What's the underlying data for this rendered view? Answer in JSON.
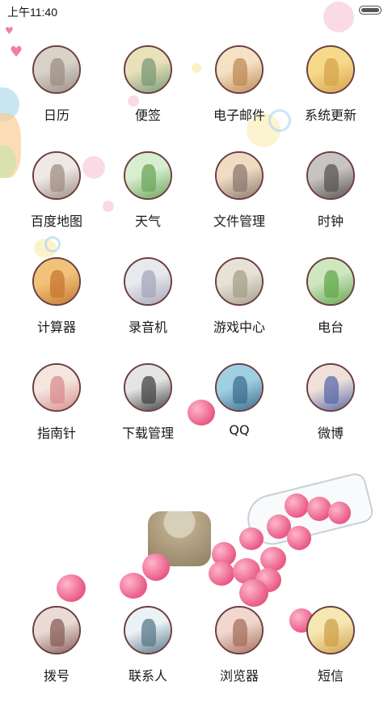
{
  "status_bar": {
    "time": "上午11:40"
  },
  "apps": [
    {
      "label": "日历",
      "icon": "photo-girl-icon",
      "palette": [
        "#d8d2c8",
        "#9c8f86"
      ]
    },
    {
      "label": "便签",
      "icon": "photo-swing-icon",
      "palette": [
        "#e9e1b9",
        "#7b9a78"
      ]
    },
    {
      "label": "电子邮件",
      "icon": "photo-couple-icon",
      "palette": [
        "#f5e2c4",
        "#c08a57"
      ]
    },
    {
      "label": "系统更新",
      "icon": "photo-sunset-icon",
      "palette": [
        "#f7d98a",
        "#d6a44c"
      ]
    },
    {
      "label": "百度地图",
      "icon": "photo-friends-icon",
      "palette": [
        "#efe9e6",
        "#a08f86"
      ]
    },
    {
      "label": "天气",
      "icon": "photo-meadow-icon",
      "palette": [
        "#d8eed0",
        "#6ea55c"
      ]
    },
    {
      "label": "文件管理",
      "icon": "photo-pier-icon",
      "palette": [
        "#f0dcc3",
        "#8b7a6f"
      ]
    },
    {
      "label": "时钟",
      "icon": "photo-couple-dark-icon",
      "palette": [
        "#c7c4c3",
        "#5a5553"
      ]
    },
    {
      "label": "计算器",
      "icon": "photo-hair-icon",
      "palette": [
        "#f2c27a",
        "#c5772f"
      ]
    },
    {
      "label": "录音机",
      "icon": "photo-seaside-icon",
      "palette": [
        "#e8e8ef",
        "#a7a7bb"
      ]
    },
    {
      "label": "游戏中心",
      "icon": "photo-lake-icon",
      "palette": [
        "#e6e3d6",
        "#a5a08a"
      ]
    },
    {
      "label": "电台",
      "icon": "photo-field-icon",
      "palette": [
        "#cfe6c1",
        "#64a84e"
      ]
    },
    {
      "label": "指南针",
      "icon": "photo-flower-icon",
      "palette": [
        "#f4e6df",
        "#d98e8e"
      ]
    },
    {
      "label": "下载管理",
      "icon": "photo-bw-girl-icon",
      "palette": [
        "#e5e5e5",
        "#444444"
      ]
    },
    {
      "label": "QQ",
      "icon": "photo-sky-icon",
      "palette": [
        "#9fd0e2",
        "#3d6f8f"
      ]
    },
    {
      "label": "微博",
      "icon": "photo-tattoo-icon",
      "palette": [
        "#efe1da",
        "#5b6aa8"
      ]
    }
  ],
  "dock": [
    {
      "label": "拨号",
      "icon": "photo-text-girl-icon",
      "palette": [
        "#eadbd7",
        "#8a5e5a"
      ]
    },
    {
      "label": "联系人",
      "icon": "photo-boy-text-icon",
      "palette": [
        "#eaf2f6",
        "#5c7889"
      ]
    },
    {
      "label": "浏览器",
      "icon": "photo-long-hair-icon",
      "palette": [
        "#f1d7cf",
        "#a7705e"
      ]
    },
    {
      "label": "短信",
      "icon": "photo-wheat-icon",
      "palette": [
        "#f6e7b3",
        "#cfa24a"
      ]
    }
  ]
}
